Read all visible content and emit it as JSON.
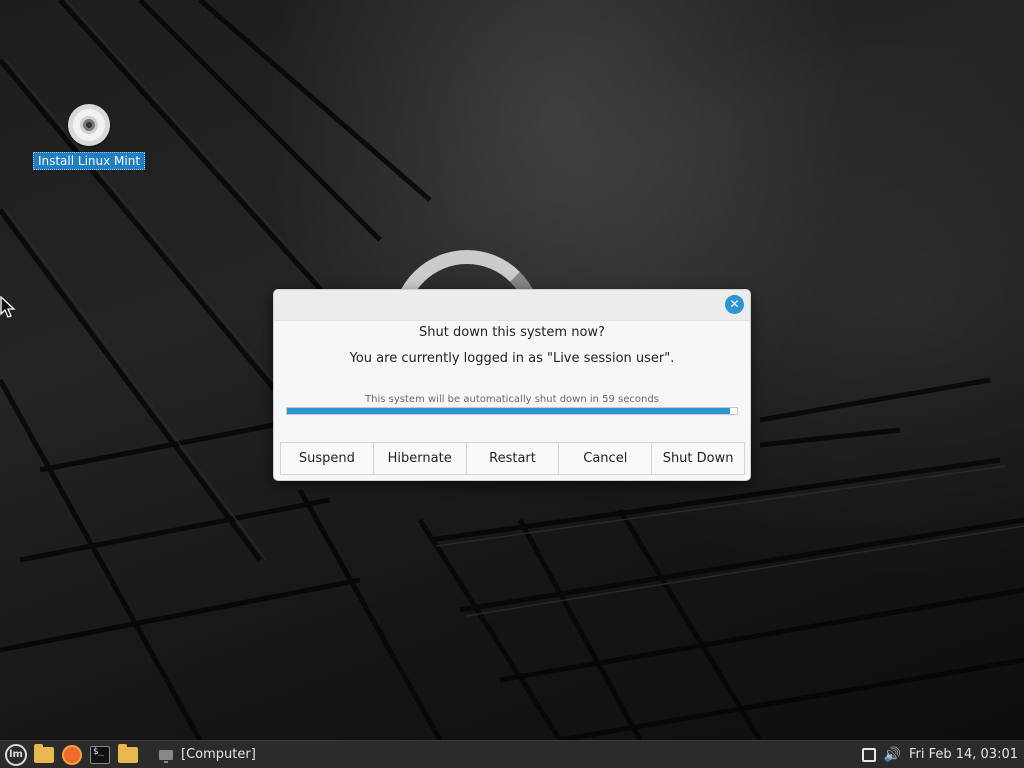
{
  "desktop": {
    "icons": [
      {
        "label": "Install Linux Mint",
        "icon": "disc-icon"
      }
    ]
  },
  "dialog": {
    "title": "Shut down this system now?",
    "subtitle": "You are currently logged in as \"Live session user\".",
    "countdown_text": "This system will be automatically shut down in 59 seconds",
    "progress_fraction": 0.985,
    "close_icon": "close-icon",
    "buttons": {
      "suspend": "Suspend",
      "hibernate": "Hibernate",
      "restart": "Restart",
      "cancel": "Cancel",
      "shutdown": "Shut Down"
    }
  },
  "taskbar": {
    "launchers": [
      "mint-menu-icon",
      "folder-icon",
      "firefox-icon",
      "terminal-icon",
      "files-icon"
    ],
    "window_label": "[Computer]",
    "clock": "Fri Feb 14, 03:01",
    "tray": [
      "network-icon",
      "volume-icon"
    ]
  },
  "colors": {
    "accent": "#2e95d3",
    "selection": "#1f7ec4",
    "panel": "#2b2b2b"
  }
}
